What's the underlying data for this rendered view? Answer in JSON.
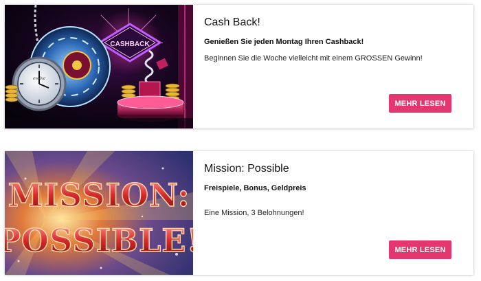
{
  "promotions": [
    {
      "title": "Cash Back!",
      "subtitle": "Genießen Sie jeden Montag Ihren Cashback!",
      "description": "Beginnen Sie die Woche vielleicht mit einem GROSSEN Gewinn!",
      "button_label": "MEHR LESEN",
      "image": {
        "sign_text": "CASHBACK",
        "clock_brand": "evolve"
      }
    },
    {
      "title": "Mission: Possible",
      "subtitle": "Freispiele, Bonus, Geldpreis",
      "description": "Eine Mission, 3 Belohnungen!",
      "button_label": "MEHR LESEN",
      "image": {
        "headline_line1": "MISSION:",
        "headline_line2": "POSSIBLE!"
      }
    }
  ],
  "colors": {
    "accent": "#e2386f",
    "card_background": "#ffffff",
    "text": "#111111"
  }
}
